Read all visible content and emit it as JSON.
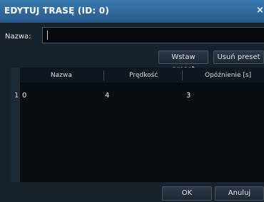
{
  "dialog": {
    "title": "EDYTUJ TRASĘ (ID: 0)",
    "close_icon": "×"
  },
  "form": {
    "name_label": "Nazwa:",
    "name_value": ""
  },
  "toolbar": {
    "insert_preset_label": "Wstaw preset",
    "delete_preset_label": "Usuń preset"
  },
  "table": {
    "columns": [
      "Nazwa",
      "Prędkość",
      "Opóźnienie [s]"
    ],
    "rows": [
      {
        "index": "1",
        "cells": [
          "0",
          "4",
          "3"
        ]
      }
    ]
  },
  "footer": {
    "ok_label": "OK",
    "cancel_label": "Anuluj"
  },
  "colors": {
    "titlebar": "#2f6ea3",
    "background": "#16232d",
    "grid": "#080d12"
  }
}
